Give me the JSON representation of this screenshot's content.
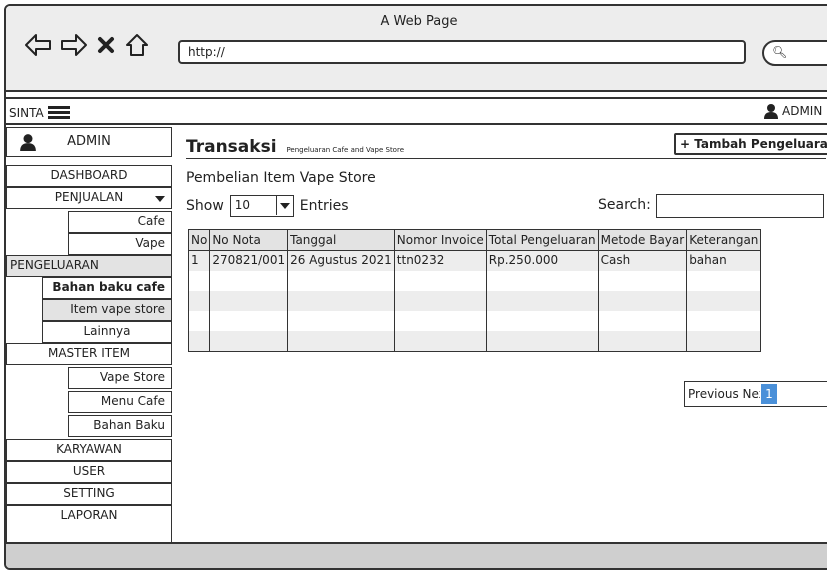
{
  "window": {
    "title": "A Web Page",
    "url": "http://"
  },
  "topbar": {
    "brand": "SINTA",
    "user": "ADMIN"
  },
  "sidebar": {
    "admin": "ADMIN",
    "items": [
      {
        "label": "DASHBOARD"
      },
      {
        "label": "PENJUALAN"
      },
      {
        "label": "Cafe"
      },
      {
        "label": "Vape"
      },
      {
        "label": "PENGELUARAN"
      },
      {
        "label": "Bahan baku cafe"
      },
      {
        "label": "Item vape store"
      },
      {
        "label": "Lainnya"
      },
      {
        "label": "MASTER ITEM"
      },
      {
        "label": "Vape Store"
      },
      {
        "label": "Menu Cafe"
      },
      {
        "label": "Bahan Baku"
      },
      {
        "label": "KARYAWAN"
      },
      {
        "label": "USER"
      },
      {
        "label": "SETTING"
      },
      {
        "label": "LAPORAN"
      }
    ]
  },
  "main": {
    "title": "Transaksi",
    "subtitle_small": "Pengeluaran Cafe and Vape Store",
    "add_button": "+ Tambah Pengeluaran",
    "section_title": "Pembelian Item Vape Store",
    "show_label": "Show",
    "show_value": "10",
    "entries_label": "Entries",
    "search_label": "Search:",
    "search_value": "",
    "table": {
      "headers": [
        "No",
        "No Nota",
        "Tanggal",
        "Nomor Invoice",
        "Total Pengeluaran",
        "Metode Bayar",
        "Keterangan"
      ],
      "rows": [
        [
          "1",
          "270821/001",
          "26 Agustus 2021",
          "ttn0232",
          "Rp.250.000",
          "Cash",
          "bahan"
        ]
      ]
    },
    "pagination": {
      "previous": "Previous Next",
      "page": "1"
    }
  }
}
